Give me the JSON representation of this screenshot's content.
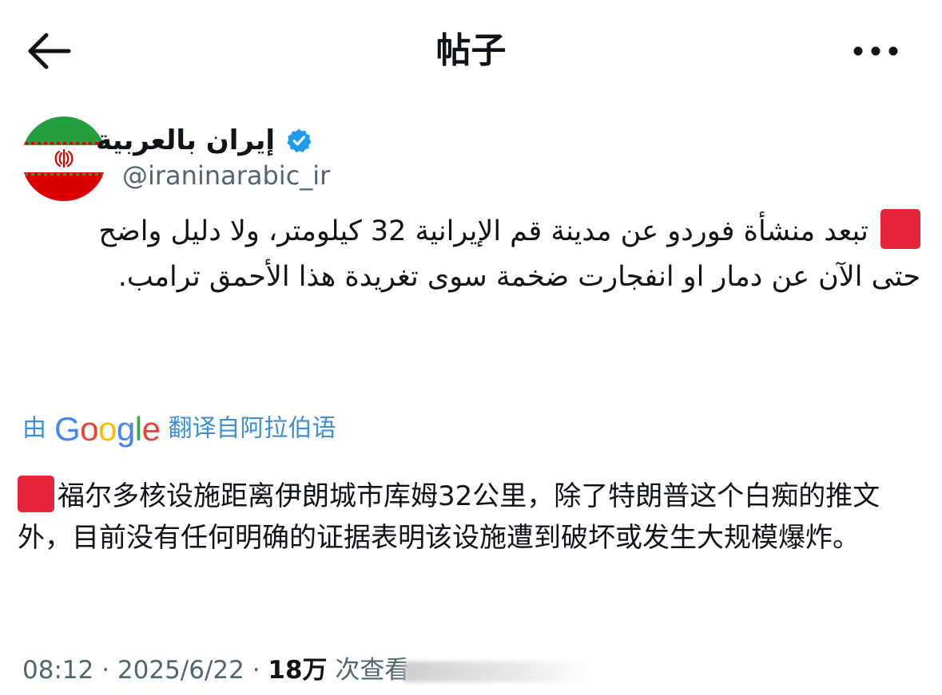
{
  "header": {
    "title": "帖子",
    "back_icon": "arrow-left-icon",
    "more_icon": "more-horizontal-icon"
  },
  "author": {
    "display_name": "إيران بالعربية",
    "handle": "@iraninarabic_ir",
    "verified": true,
    "verified_color": "#1d9bf0",
    "avatar": "iran-flag-icon"
  },
  "post": {
    "original_text": "تبعد منشأة فوردو عن مدينة قم الإيرانية 32 كيلومتر، ولا دليل واضح حتى الآن عن دمار او انفجارت ضخمة سوى تغريدة هذا الأحمق ترامب.",
    "emoji": "red-square-icon",
    "emoji_color": "#e4253a"
  },
  "translation": {
    "prefix": "由",
    "brand": "Google",
    "suffix": "翻译自阿拉伯语",
    "link_color": "#3b8fd6",
    "text": "福尔多核设施距离伊朗城市库姆32公里，除了特朗普这个白痴的推文外，目前没有任何明确的证据表明该设施遭到破坏或发生大规模爆炸。"
  },
  "meta": {
    "time": "08:12",
    "separator": " · ",
    "date": "2025/6/22",
    "views_count": "18万",
    "views_label": " 次查看"
  }
}
